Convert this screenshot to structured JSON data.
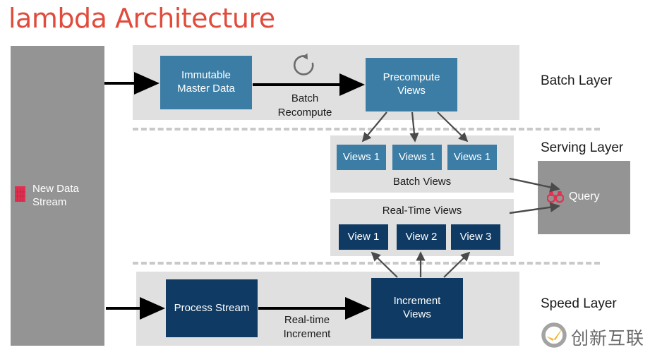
{
  "title": "lambda Architecture",
  "colors": {
    "title_red": "#e14b3c",
    "box_blue": "#3b7da5",
    "box_navy": "#0e3a63",
    "panel_gray": "#e0e0e0",
    "dark_gray": "#949494",
    "divider_gray": "#c9c9c9",
    "icon_red": "#e03050",
    "watermark_orange": "#f0a818"
  },
  "stream": {
    "icon": "database-icon",
    "label_line1": "New Data",
    "label_line2": "Stream"
  },
  "batch_layer": {
    "label": "Batch Layer",
    "master_data": "Immutable\nMaster Data",
    "master_data_line1": "Immutable",
    "master_data_line2": "Master Data",
    "recompute_icon": "refresh-circular-arrow-icon",
    "recompute_label_line1": "Batch",
    "recompute_label_line2": "Recompute",
    "precompute": "Precompute\nViews",
    "precompute_line1": "Precompute",
    "precompute_line2": "Views"
  },
  "serving_layer": {
    "label": "Serving Layer",
    "batch_views": {
      "title": "Batch Views",
      "views": [
        "Views 1",
        "Views 1",
        "Views 1"
      ]
    },
    "realtime_views": {
      "title": "Real-Time Views",
      "views": [
        "View 1",
        "View 2",
        "View 3"
      ]
    },
    "query": {
      "icon": "binoculars-icon",
      "label": "Query"
    }
  },
  "speed_layer": {
    "label": "Speed Layer",
    "process_stream": "Process Stream",
    "increment_label_line1": "Real-time",
    "increment_label_line2": "Increment",
    "increment_views_line1": "Increment",
    "increment_views_line2": "Views"
  },
  "watermark": {
    "icon": "circle-swoosh-logo",
    "text": "创新互联"
  }
}
